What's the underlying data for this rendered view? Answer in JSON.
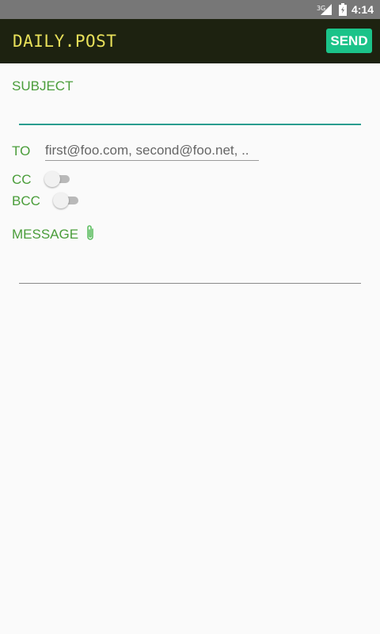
{
  "status_bar": {
    "time": "4:14",
    "network_label": "3G"
  },
  "app_bar": {
    "title": "DAILY.POST",
    "send_label": "SEND"
  },
  "form": {
    "subject_label": "SUBJECT",
    "subject_value": "",
    "to_label": "TO",
    "to_placeholder": "first@foo.com, second@foo.net, ..",
    "cc_label": "CC",
    "cc_enabled": false,
    "bcc_label": "BCC",
    "bcc_enabled": false,
    "message_label": "MESSAGE",
    "message_value": ""
  },
  "icons": {
    "attach": "paperclip-icon",
    "signal": "signal-icon",
    "battery": "battery-icon"
  },
  "colors": {
    "app_bar": "#1d2210",
    "title": "#e8e05a",
    "send_button": "#1bc389",
    "label": "#4a9d3a",
    "accent_line": "#2a9d8f"
  }
}
